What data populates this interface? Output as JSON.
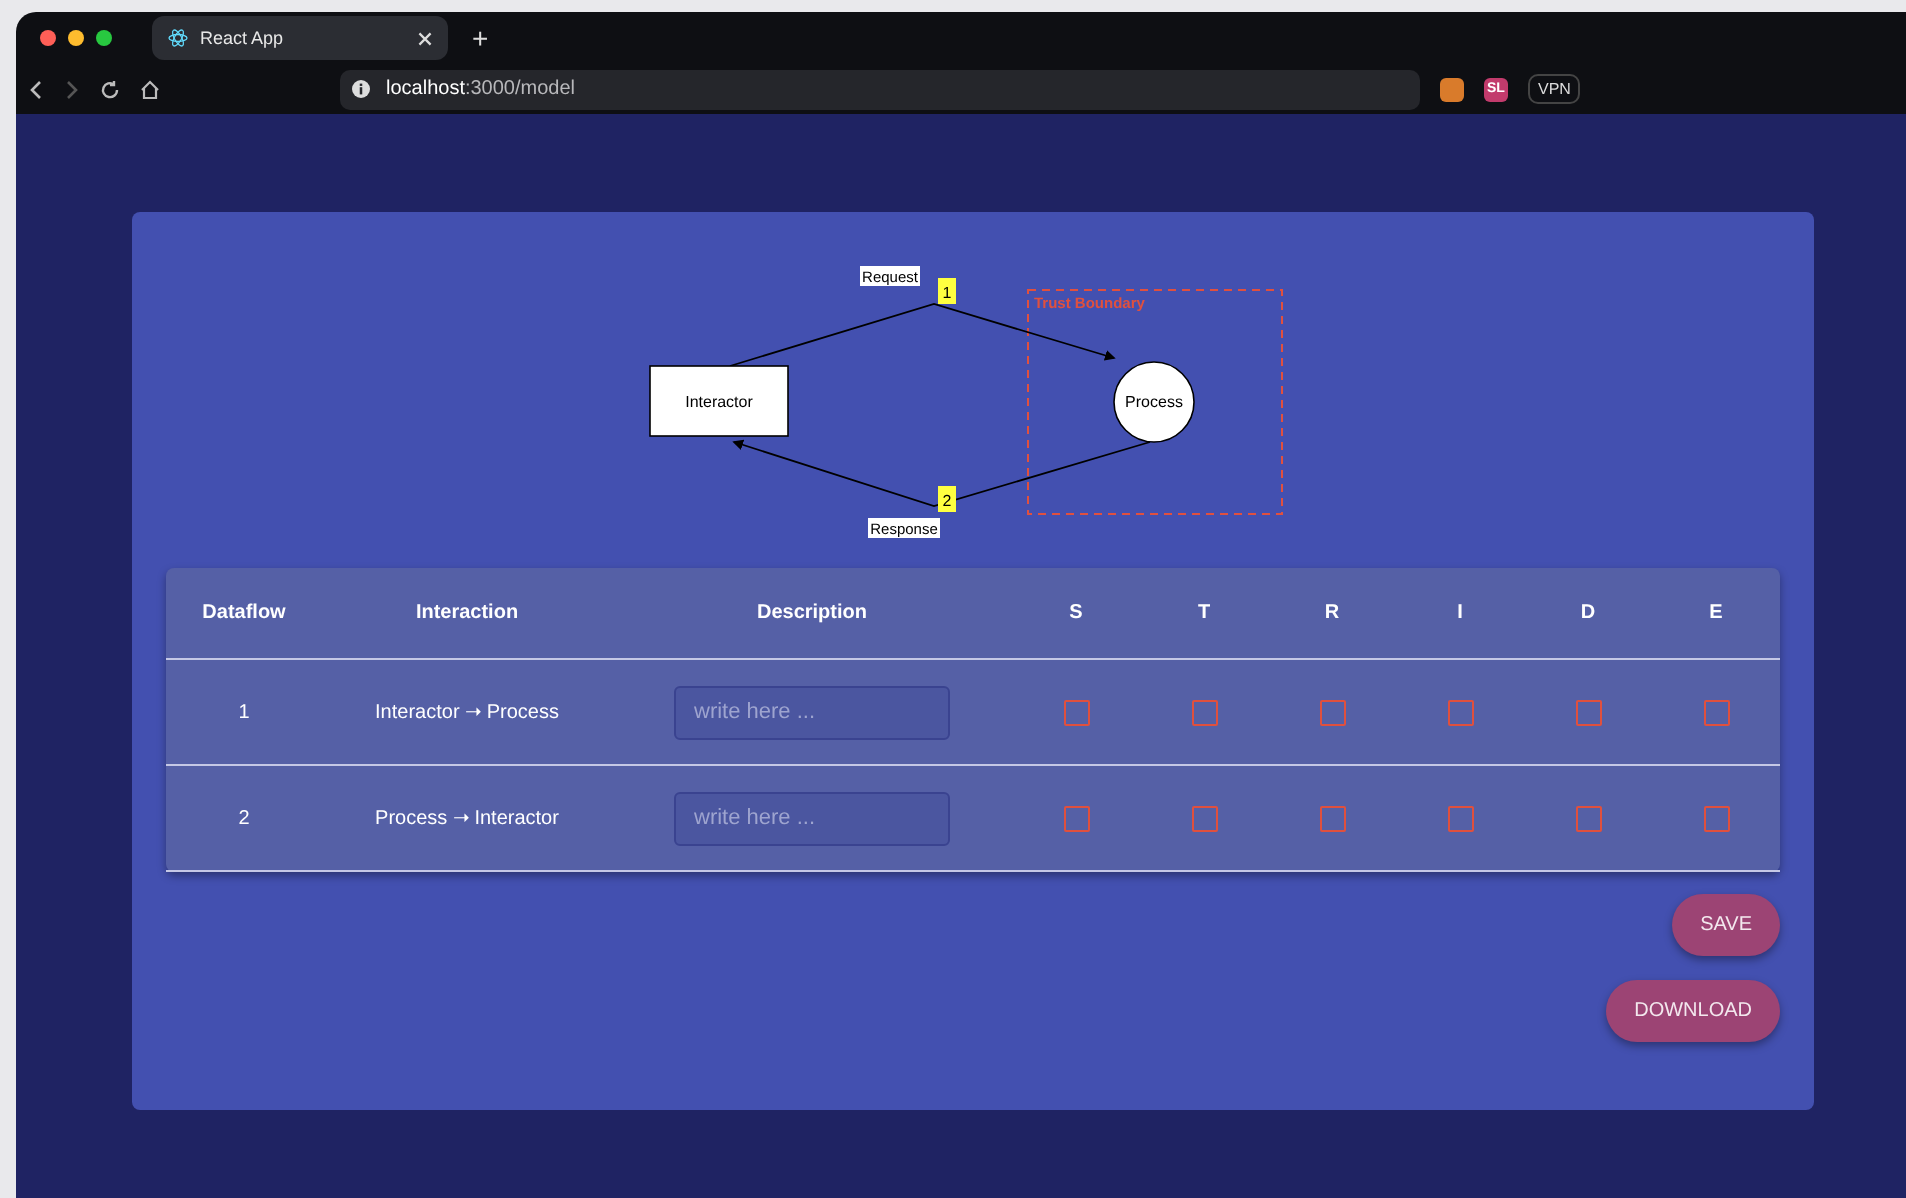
{
  "browser": {
    "tab": {
      "title": "React App",
      "selected": true
    },
    "new_tab": "+",
    "url": {
      "host": "localhost",
      "path": ":3000/model"
    },
    "extensions": [
      {
        "kind": "icon"
      },
      {
        "kind": "badge",
        "label": "SL"
      }
    ],
    "vpn": "VPN"
  },
  "diagram": {
    "nodes": [
      {
        "kind": "interactor",
        "label": "Interactor"
      },
      {
        "kind": "process",
        "label": "Process"
      }
    ],
    "flows": [
      {
        "number": "1",
        "label": "Request"
      },
      {
        "number": "2",
        "label": "Response"
      }
    ],
    "boundary": {
      "label": "Trust Boundary"
    }
  },
  "table": {
    "columns": [
      "Dataflow",
      "Interaction",
      "Description",
      "S",
      "T",
      "R",
      "I",
      "D",
      "E"
    ],
    "rows": [
      {
        "dataflow": "1",
        "interaction": "Interactor ➝ Process",
        "placeholder": "write here ...",
        "threats": [
          {
            "checked": false
          },
          {
            "checked": false
          },
          {
            "checked": false
          },
          {
            "checked": false
          },
          {
            "checked": false
          },
          {
            "checked": false
          }
        ]
      },
      {
        "dataflow": "2",
        "interaction": "Process ➝ Interactor",
        "placeholder": "write here ...",
        "threats": [
          {
            "checked": false
          },
          {
            "checked": false
          },
          {
            "checked": false
          },
          {
            "checked": false
          },
          {
            "checked": false
          },
          {
            "checked": false
          }
        ]
      }
    ]
  },
  "buttons": [
    "SAVE",
    "DOWNLOAD"
  ]
}
